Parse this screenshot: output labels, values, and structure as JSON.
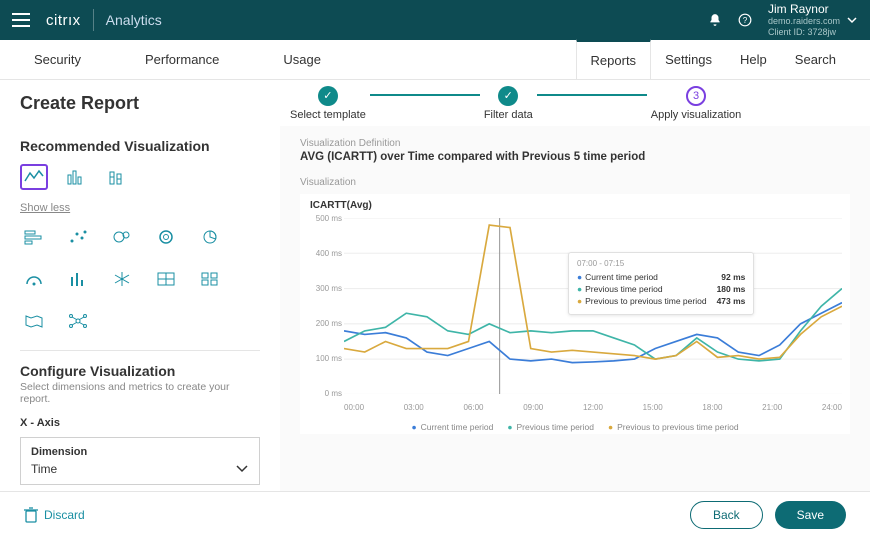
{
  "header": {
    "brand": "citrıx",
    "product": "Analytics",
    "user": {
      "name": "Jim Raynor",
      "domain": "demo.raiders.com",
      "client_id": "Client ID: 3728jw"
    }
  },
  "nav": {
    "left": [
      "Security",
      "Performance",
      "Usage"
    ],
    "right": [
      "Reports",
      "Settings",
      "Help",
      "Search"
    ],
    "active": "Reports"
  },
  "page": {
    "title": "Create Report"
  },
  "steps": [
    {
      "label": "Select template",
      "state": "done"
    },
    {
      "label": "Filter data",
      "state": "done"
    },
    {
      "label": "Apply visualization",
      "state": "active",
      "num": "3"
    }
  ],
  "left": {
    "rec_title": "Recommended Visualization",
    "show_less": "Show less",
    "configure_title": "Configure Visualization",
    "configure_sub": "Select dimensions and metrics to create your report.",
    "x_axis": "X - Axis",
    "dimension_label": "Dimension",
    "dimension_value": "Time"
  },
  "viz": {
    "def_label": "Visualization Definition",
    "def_text": "AVG (ICARTT) over Time compared with Previous 5 time period",
    "viz_label": "Visualization",
    "chart_title": "ICARTT(Avg)"
  },
  "chart_data": {
    "type": "line",
    "ylabel": "ICARTT(Avg)",
    "y_ticks": [
      "500 ms",
      "400 ms",
      "300 ms",
      "200 ms",
      "100 ms",
      "0 ms"
    ],
    "x_ticks": [
      "00:00",
      "03:00",
      "06:00",
      "09:00",
      "12:00",
      "15:00",
      "18:00",
      "21:00",
      "24:00"
    ],
    "ylim": [
      0,
      500
    ],
    "series": [
      {
        "name": "Current time period",
        "color": "#3b7dd8",
        "values": [
          180,
          170,
          175,
          160,
          120,
          110,
          130,
          150,
          100,
          95,
          100,
          90,
          92,
          95,
          100,
          130,
          150,
          170,
          160,
          120,
          110,
          140,
          200,
          230,
          260
        ]
      },
      {
        "name": "Previous time period",
        "color": "#3fb5a8",
        "values": [
          150,
          180,
          190,
          230,
          220,
          180,
          170,
          200,
          175,
          180,
          175,
          180,
          180,
          160,
          140,
          100,
          110,
          160,
          120,
          100,
          95,
          100,
          180,
          250,
          300
        ]
      },
      {
        "name": "Previous to previous time period",
        "color": "#d9a93e",
        "values": [
          130,
          120,
          150,
          130,
          130,
          130,
          150,
          480,
          473,
          130,
          120,
          125,
          120,
          115,
          110,
          100,
          110,
          150,
          105,
          110,
          100,
          105,
          170,
          220,
          250
        ]
      }
    ],
    "tooltip": {
      "time": "07:00 - 07:15",
      "rows": [
        {
          "label": "Current time period",
          "value": "92 ms",
          "color": "#3b7dd8"
        },
        {
          "label": "Previous time period",
          "value": "180 ms",
          "color": "#3fb5a8"
        },
        {
          "label": "Previous to previous time period",
          "value": "473 ms",
          "color": "#d9a93e"
        }
      ]
    }
  },
  "footer": {
    "discard": "Discard",
    "back": "Back",
    "save": "Save"
  }
}
